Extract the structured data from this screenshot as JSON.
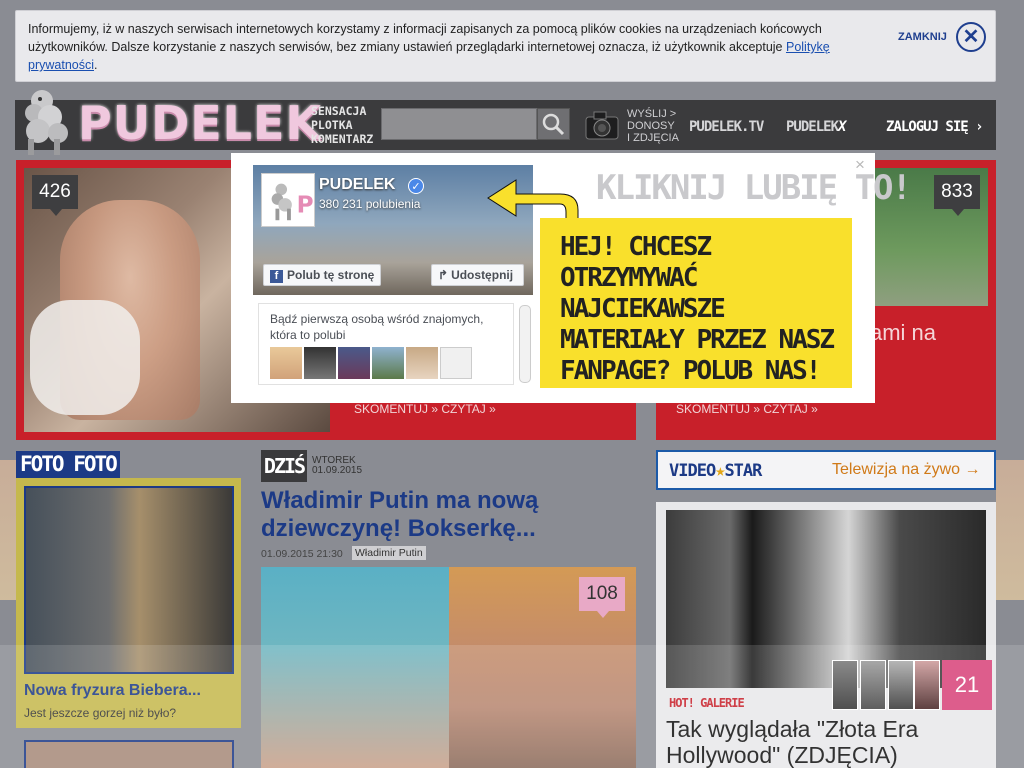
{
  "cookie_bar": {
    "text": "Informujemy, iż w naszych serwisach internetowych korzystamy z informacji zapisanych za pomocą plików cookies na urządzeniach końcowych użytkowników. Dalsze korzystanie z naszych serwisów, bez zmiany ustawień przeglądarki internetowej oznacza, iż użytkownik akceptuje ",
    "link": "Politykę prywatności",
    "suffix": ".",
    "close_label": "ZAMKNIJ"
  },
  "header": {
    "logo": "PUDELEK",
    "tagline": [
      "SENSACJA",
      "PLOTKA",
      "KOMENTARZ"
    ],
    "search_placeholder": "",
    "send_label": [
      "WYŚLIJ >",
      "DONOSY",
      "I ZDJĘCIA"
    ],
    "nav": [
      "PUDELEK.TV",
      "PUDELEK",
      "ZALOGUJ SIĘ"
    ],
    "nav_x": "X"
  },
  "cards": {
    "left_badge": "426",
    "left_actions": "SKOMENTUJ »     CZYTAJ »",
    "right_badge": "833",
    "right_title": "ami na",
    "right_actions": "SKOMENTUJ »     CZYTAJ »"
  },
  "popup": {
    "close": "×",
    "page_name": "PUDELEK",
    "likes": "380 231 polubienia",
    "like_button": "Polub tę stronę",
    "share_button": "Udostępnij",
    "friends_text": "Bądź pierwszą osobą wśród znajomych, która to polubi",
    "kliknij": "KLIKNIJ LUBIĘ TO!",
    "promo": "HEJ! CHCESZ OTRZYMYWAĆ NAJCIEKAWSZE MATERIAŁY PRZEZ NASZ FANPAGE? POLUB NAS!"
  },
  "foto": {
    "tag": "FOTO FOTO",
    "title": "Nowa fryzura Biebera...",
    "subtitle": "Jest jeszcze gorzej niż było?"
  },
  "main": {
    "dzis": "DZIŚ",
    "day": "WTOREK",
    "date": "01.09.2015",
    "title": "Władimir Putin ma nową dziewczynę! Bokserkę...",
    "meta": "01.09.2015 21:30",
    "tag": "Władimir Putin",
    "badge": "108"
  },
  "side": {
    "videostar_a": "VIDEO",
    "videostar_b": "STAR",
    "videostar_link": "Telewizja na żywo →",
    "gallery_count": "21",
    "gallery_tag": "HOT! GALERIE",
    "gallery_title": "Tak wyglądała \"Złota Era Hollywood\" (ZDJĘCIA)"
  },
  "colors": {
    "brand_red": "#c8202a",
    "brand_blue": "#1c3a86",
    "promo_yellow": "#f9e02c",
    "fb_blue": "#4b88e8"
  }
}
